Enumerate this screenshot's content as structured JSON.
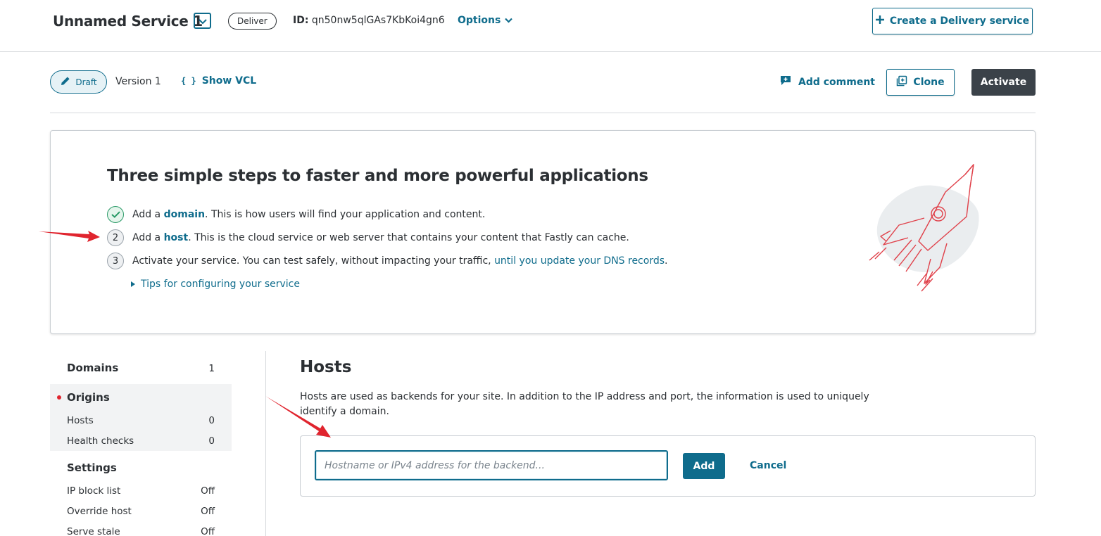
{
  "header": {
    "service_name": "Unnamed Service 1",
    "service_type": "Deliver",
    "id_label": "ID:",
    "id_value": "qn50nw5qlGAs7KbKoi4gn6",
    "options_label": "Options",
    "create_label": "Create a Delivery service"
  },
  "version_bar": {
    "status": "Draft",
    "version": "Version 1",
    "show_vcl": "Show VCL",
    "add_comment": "Add comment",
    "clone": "Clone",
    "activate": "Activate"
  },
  "steps": {
    "title": "Three simple steps to faster and more powerful applications",
    "items": [
      {
        "marker": "check",
        "prefix": "Add a ",
        "link": "domain",
        "suffix": ". This is how users will find your application and content."
      },
      {
        "marker": "2",
        "prefix": "Add a ",
        "link": "host",
        "suffix": ". This is the cloud service or web server that contains your content that Fastly can cache."
      },
      {
        "marker": "3",
        "prefix": "Activate your service. You can test safely, without impacting your traffic, ",
        "link": "until you update your DNS records",
        "suffix": "."
      }
    ],
    "tips": "Tips for configuring your service"
  },
  "sidebar": {
    "domains": {
      "label": "Domains",
      "count": "1"
    },
    "origins": {
      "label": "Origins",
      "items": [
        {
          "label": "Hosts",
          "value": "0"
        },
        {
          "label": "Health checks",
          "value": "0"
        }
      ]
    },
    "settings": {
      "label": "Settings",
      "items": [
        {
          "label": "IP block list",
          "value": "Off"
        },
        {
          "label": "Override host",
          "value": "Off"
        },
        {
          "label": "Serve stale",
          "value": "Off"
        }
      ]
    }
  },
  "hosts": {
    "title": "Hosts",
    "description": "Hosts are used as backends for your site. In addition to the IP address and port, the information is used to uniquely identify a domain.",
    "input_placeholder": "Hostname or IPv4 address for the backend...",
    "input_value": "",
    "add_label": "Add",
    "cancel_label": "Cancel"
  },
  "colors": {
    "accent": "#0f6c8c",
    "dark_button": "#3b4249",
    "success": "#2a9a67",
    "annotation_arrow": "#e0242e",
    "rocket": "#e0414a"
  },
  "icons": {
    "service_dropdown": "chevron-down-icon",
    "create": "plus-icon",
    "draft": "pencil-icon",
    "vcl": "braces-icon",
    "comment": "comment-plus-icon",
    "clone": "clone-icon",
    "tips": "caret-right-icon",
    "illustration": "rocket-illustration"
  }
}
